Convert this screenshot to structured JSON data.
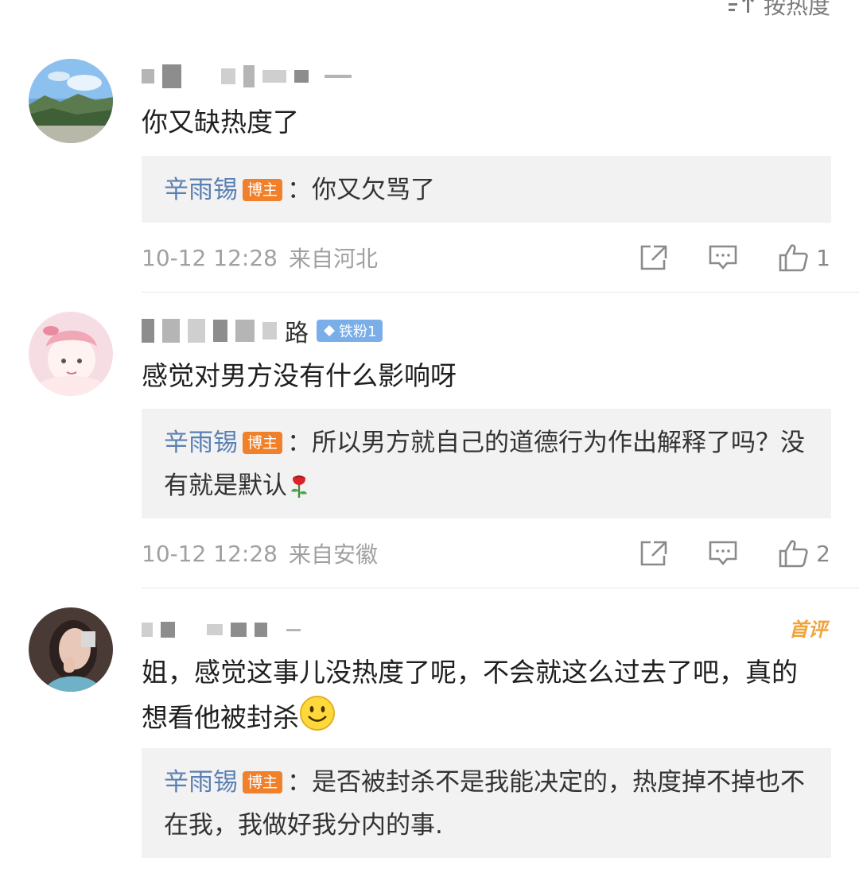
{
  "sort": {
    "label": "按热度"
  },
  "comments": [
    {
      "username_tail": "",
      "text": "你又缺热度了",
      "reply": {
        "author": "辛雨锡",
        "badge": "博主",
        "text": "：你又欠骂了",
        "emoji": ""
      },
      "time": "10-12 12:28",
      "location": "来自河北",
      "likes": "1"
    },
    {
      "username_tail": "路",
      "fan_badge": "铁粉1",
      "text": "感觉对男方没有什么影响呀",
      "reply": {
        "author": "辛雨锡",
        "badge": "博主",
        "text": "：所以男方就自己的道德行为作出解释了吗？没有就是默认",
        "emoji": "rose"
      },
      "time": "10-12 12:28",
      "location": "来自安徽",
      "likes": "2"
    },
    {
      "username_tail": "",
      "first_badge": "首评",
      "text": "姐，感觉这事儿没热度了呢，不会就这么过去了吧，真的想看他被封杀",
      "text_emoji": "smile",
      "reply": {
        "author": "辛雨锡",
        "badge": "博主",
        "text": "：是否被封杀不是我能决定的，热度掉不掉也不在我，我做好我分内的事.",
        "emoji": ""
      }
    }
  ],
  "colors": {
    "reply_author": "#5a7fb3",
    "host_badge": "#f0802a",
    "fan_badge": "#7aaee9",
    "first_badge": "#f0a23b",
    "reply_bg": "#f2f2f2"
  }
}
